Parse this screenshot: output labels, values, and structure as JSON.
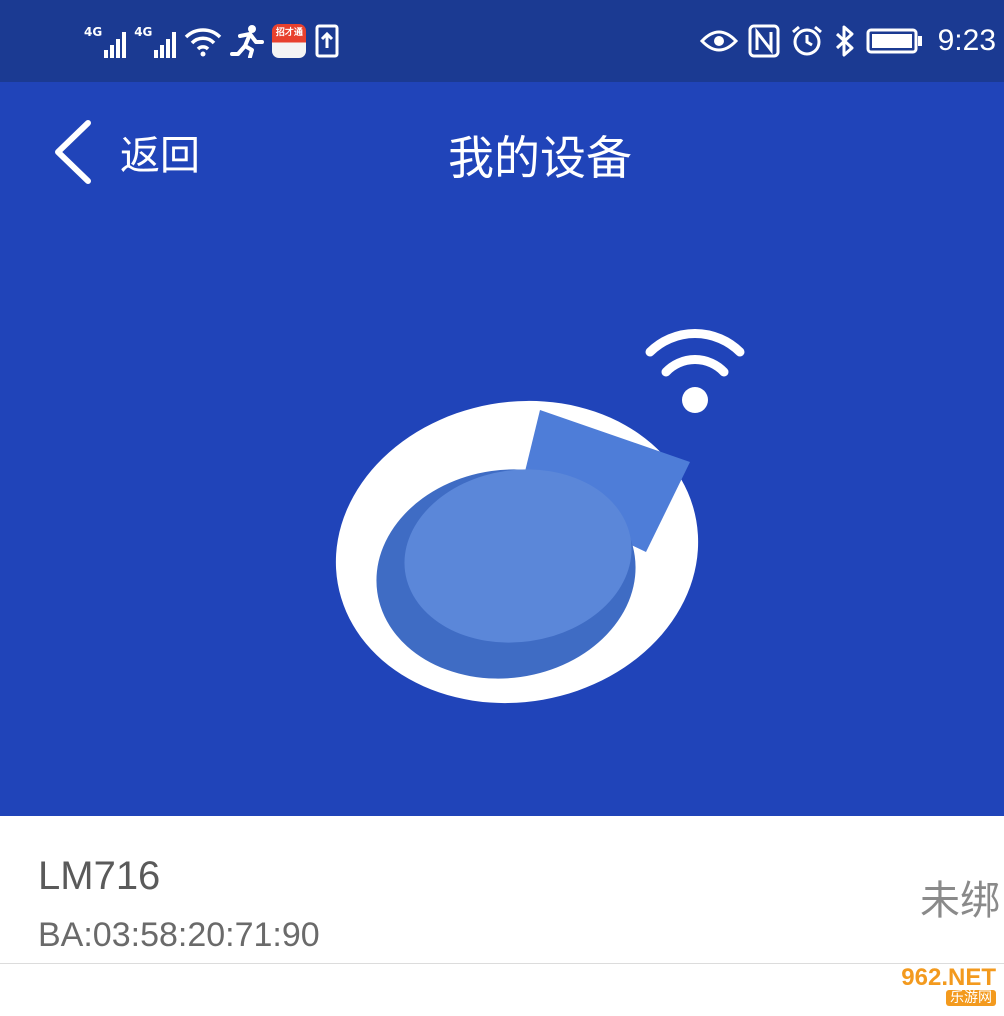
{
  "status_bar": {
    "network1": "4G",
    "network2": "4G",
    "app_icon_text": "招才通",
    "time": "9:23",
    "icons": [
      "signal-icon",
      "wifi-icon",
      "running-man-icon",
      "upload-icon",
      "eye-icon",
      "nfc-icon",
      "alarm-icon",
      "bluetooth-icon",
      "battery-icon"
    ]
  },
  "header": {
    "back_label": "返回",
    "title": "我的设备"
  },
  "colors": {
    "status_bar": "#1b3a92",
    "header": "#2044b9",
    "device_fill": "#5b87d9",
    "device_shadow": "#3f6cc4"
  },
  "device": {
    "name": "LM716",
    "mac": "BA:03:58:20:71:90",
    "status": "未绑"
  },
  "watermark": {
    "top": "962.NET",
    "bottom": "乐游网"
  }
}
